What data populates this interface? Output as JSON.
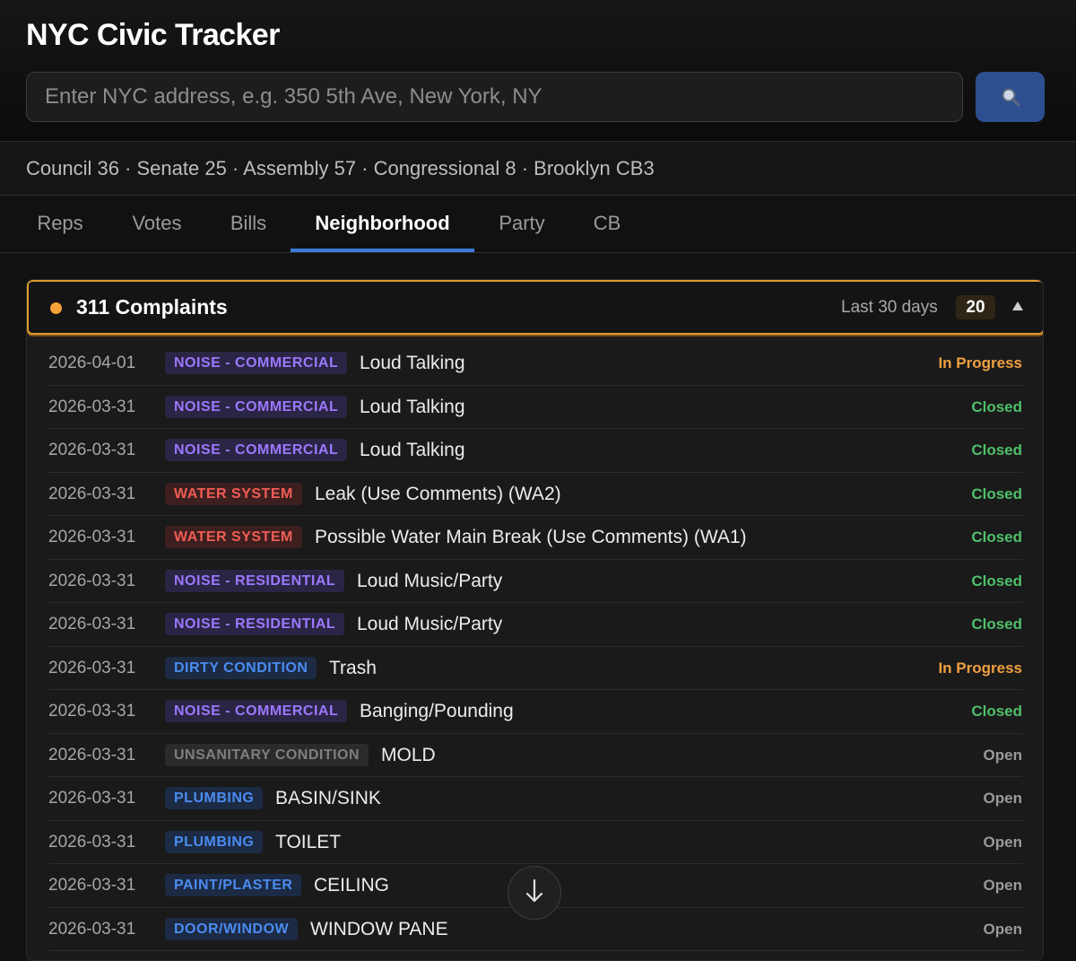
{
  "app": {
    "title": "NYC Civic Tracker"
  },
  "search": {
    "placeholder": "Enter NYC address, e.g. 350 5th Ave, New York, NY",
    "value": "",
    "button_icon": "search-icon"
  },
  "districts": {
    "text": "Council 36 · Senate 25 · Assembly 57 · Congressional 8 · Brooklyn CB3"
  },
  "tabs": [
    {
      "label": "Reps",
      "active": false
    },
    {
      "label": "Votes",
      "active": false
    },
    {
      "label": "Bills",
      "active": false
    },
    {
      "label": "Neighborhood",
      "active": true
    },
    {
      "label": "Party",
      "active": false
    },
    {
      "label": "CB",
      "active": false
    }
  ],
  "complaints": {
    "title": "311 Complaints",
    "range": "Last 30 days",
    "count": "20",
    "collapse_icon": "triangle-up-icon",
    "rows": [
      {
        "date": "2026-04-01",
        "category": "NOISE - COMMERCIAL",
        "color": "purple",
        "description": "Loud Talking",
        "status": "In Progress",
        "state": "progress"
      },
      {
        "date": "2026-03-31",
        "category": "NOISE - COMMERCIAL",
        "color": "purple",
        "description": "Loud Talking",
        "status": "Closed",
        "state": "closed"
      },
      {
        "date": "2026-03-31",
        "category": "NOISE - COMMERCIAL",
        "color": "purple",
        "description": "Loud Talking",
        "status": "Closed",
        "state": "closed"
      },
      {
        "date": "2026-03-31",
        "category": "WATER SYSTEM",
        "color": "red",
        "description": "Leak (Use Comments) (WA2)",
        "status": "Closed",
        "state": "closed"
      },
      {
        "date": "2026-03-31",
        "category": "WATER SYSTEM",
        "color": "red",
        "description": "Possible Water Main Break (Use Comments) (WA1)",
        "status": "Closed",
        "state": "closed"
      },
      {
        "date": "2026-03-31",
        "category": "NOISE - RESIDENTIAL",
        "color": "purple",
        "description": "Loud Music/Party",
        "status": "Closed",
        "state": "closed"
      },
      {
        "date": "2026-03-31",
        "category": "NOISE - RESIDENTIAL",
        "color": "purple",
        "description": "Loud Music/Party",
        "status": "Closed",
        "state": "closed"
      },
      {
        "date": "2026-03-31",
        "category": "DIRTY CONDITION",
        "color": "blue",
        "description": "Trash",
        "status": "In Progress",
        "state": "progress"
      },
      {
        "date": "2026-03-31",
        "category": "NOISE - COMMERCIAL",
        "color": "purple",
        "description": "Banging/Pounding",
        "status": "Closed",
        "state": "closed"
      },
      {
        "date": "2026-03-31",
        "category": "UNSANITARY CONDITION",
        "color": "gray",
        "description": "MOLD",
        "status": "Open",
        "state": "open"
      },
      {
        "date": "2026-03-31",
        "category": "PLUMBING",
        "color": "blue",
        "description": "BASIN/SINK",
        "status": "Open",
        "state": "open"
      },
      {
        "date": "2026-03-31",
        "category": "PLUMBING",
        "color": "blue",
        "description": "TOILET",
        "status": "Open",
        "state": "open"
      },
      {
        "date": "2026-03-31",
        "category": "PAINT/PLASTER",
        "color": "blue",
        "description": "CEILING",
        "status": "Open",
        "state": "open"
      },
      {
        "date": "2026-03-31",
        "category": "DOOR/WINDOW",
        "color": "blue",
        "description": "WINDOW PANE",
        "status": "Open",
        "state": "open"
      }
    ]
  },
  "scroll_button": {
    "icon": "arrow-down-icon"
  },
  "colors": {
    "background": "#111111",
    "accent_blue": "#3b7bd8",
    "panel_border": "#e09b2d",
    "status_in_progress": "#f0a040",
    "status_closed": "#4fbf6a",
    "status_open": "#9a9a9a"
  }
}
